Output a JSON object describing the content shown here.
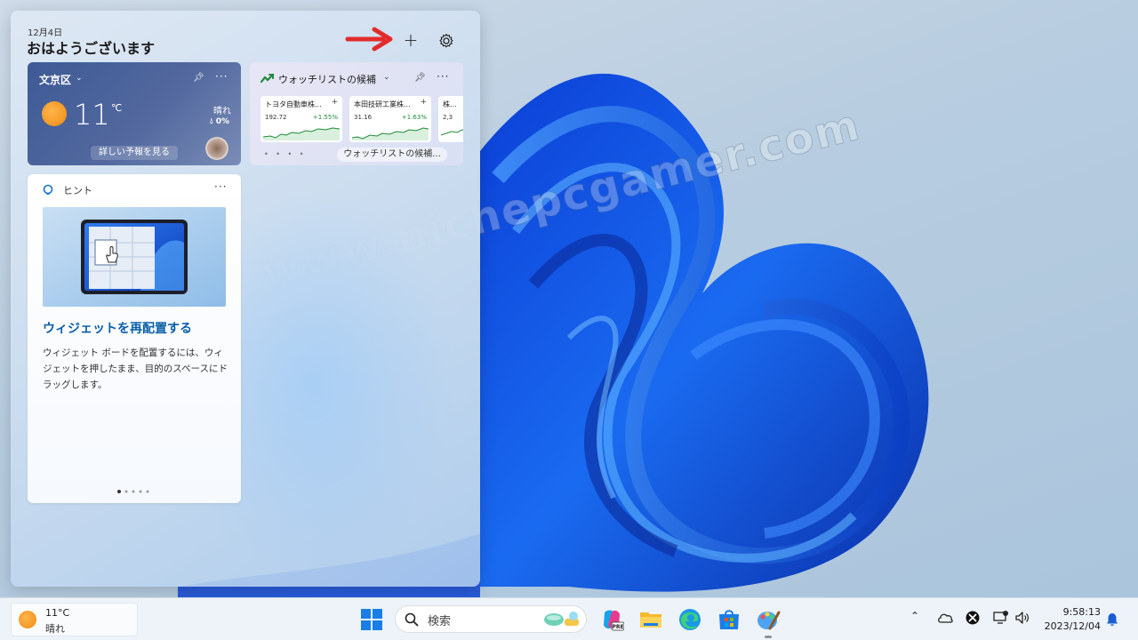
{
  "panel": {
    "date": "12月4日",
    "greeting": "おはようございます",
    "add_label": "+"
  },
  "weather": {
    "location": "文京区",
    "temperature": "11",
    "unit": "℃",
    "condition": "晴れ",
    "precip": "0%",
    "forecast_link": "詳しい予報を見る"
  },
  "watchlist": {
    "title": "ウォッチリストの候補",
    "link": "ウォッチリストの候補...",
    "dots": "• • • •",
    "stocks": [
      {
        "name": "トヨタ自動車株...",
        "price": "192.72",
        "change": "+1.55%"
      },
      {
        "name": "本田技研工業株...",
        "price": "31.16",
        "change": "+1.63%"
      },
      {
        "name": "株...",
        "price": "2,3",
        "change": ""
      }
    ]
  },
  "tips": {
    "label": "ヒント",
    "title": "ウィジェットを再配置する",
    "body": "ウィジェット ボードを配置するには、ウィジェットを押したまま、目的のスペースにドラッグします。"
  },
  "watermark": "www.nichepcgamer.com",
  "taskbar": {
    "weather_temp": "11°C",
    "weather_condition": "晴れ",
    "search_placeholder": "検索",
    "time": "9:58:13",
    "date": "2023/12/04"
  },
  "colors": {
    "accent": "#0a5fa8",
    "weather_card": "#4a6298",
    "arrow": "#e32b2b",
    "stock_up": "#1f8a3a"
  }
}
